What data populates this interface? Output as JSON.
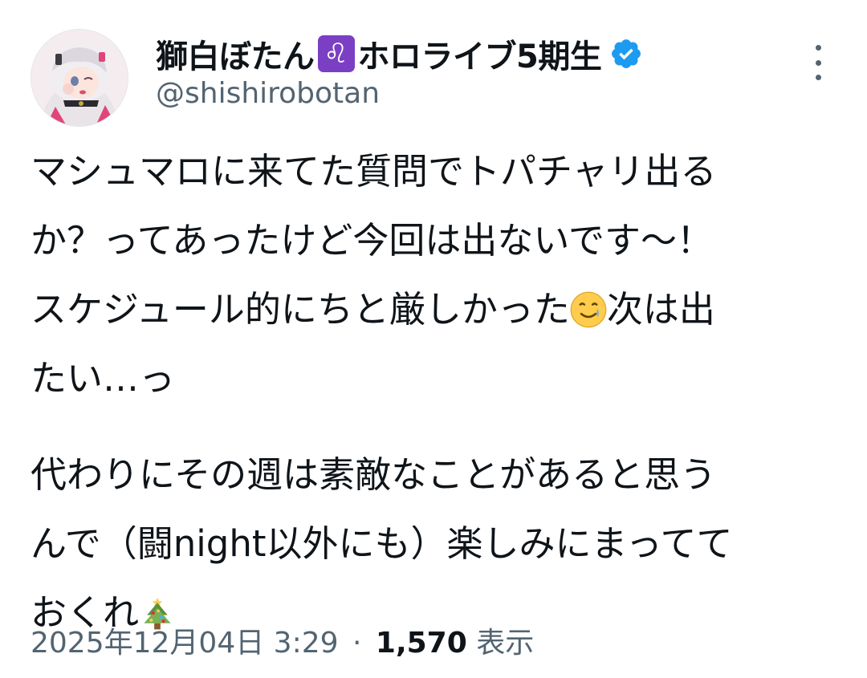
{
  "author": {
    "display_name": "獅白ぼたん",
    "name_badge_glyph": "♌",
    "name_suffix": "ホロライブ5期生",
    "handle": "@shishirobotan",
    "verified_color": "#1d9bf0",
    "avatar_icon": "profile-avatar"
  },
  "post": {
    "lines": {
      "l1": "マシュマロに来てた質問でトパチャリ出る",
      "l2": "か？ってあったけど今回は出ないです～！",
      "l3a": "スケジュール的にちと厳しかった",
      "l3b": "次は出",
      "l4": "たい…っ",
      "l5": "代わりにその週は素敵なことがあると思う",
      "l6": "んで（闘night以外にも）楽しみにまってて",
      "l7": "おくれ"
    },
    "emojis": [
      "smiling-face-with-tear-icon",
      "christmas-tree-icon"
    ]
  },
  "meta": {
    "timestamp": "2025年12月04日 3:29",
    "separator": "·",
    "views_count": "1,570",
    "views_label": "表示"
  },
  "colors": {
    "text_primary": "#0f1419",
    "text_secondary": "#536471",
    "leo_badge": "#7b3fc4"
  }
}
